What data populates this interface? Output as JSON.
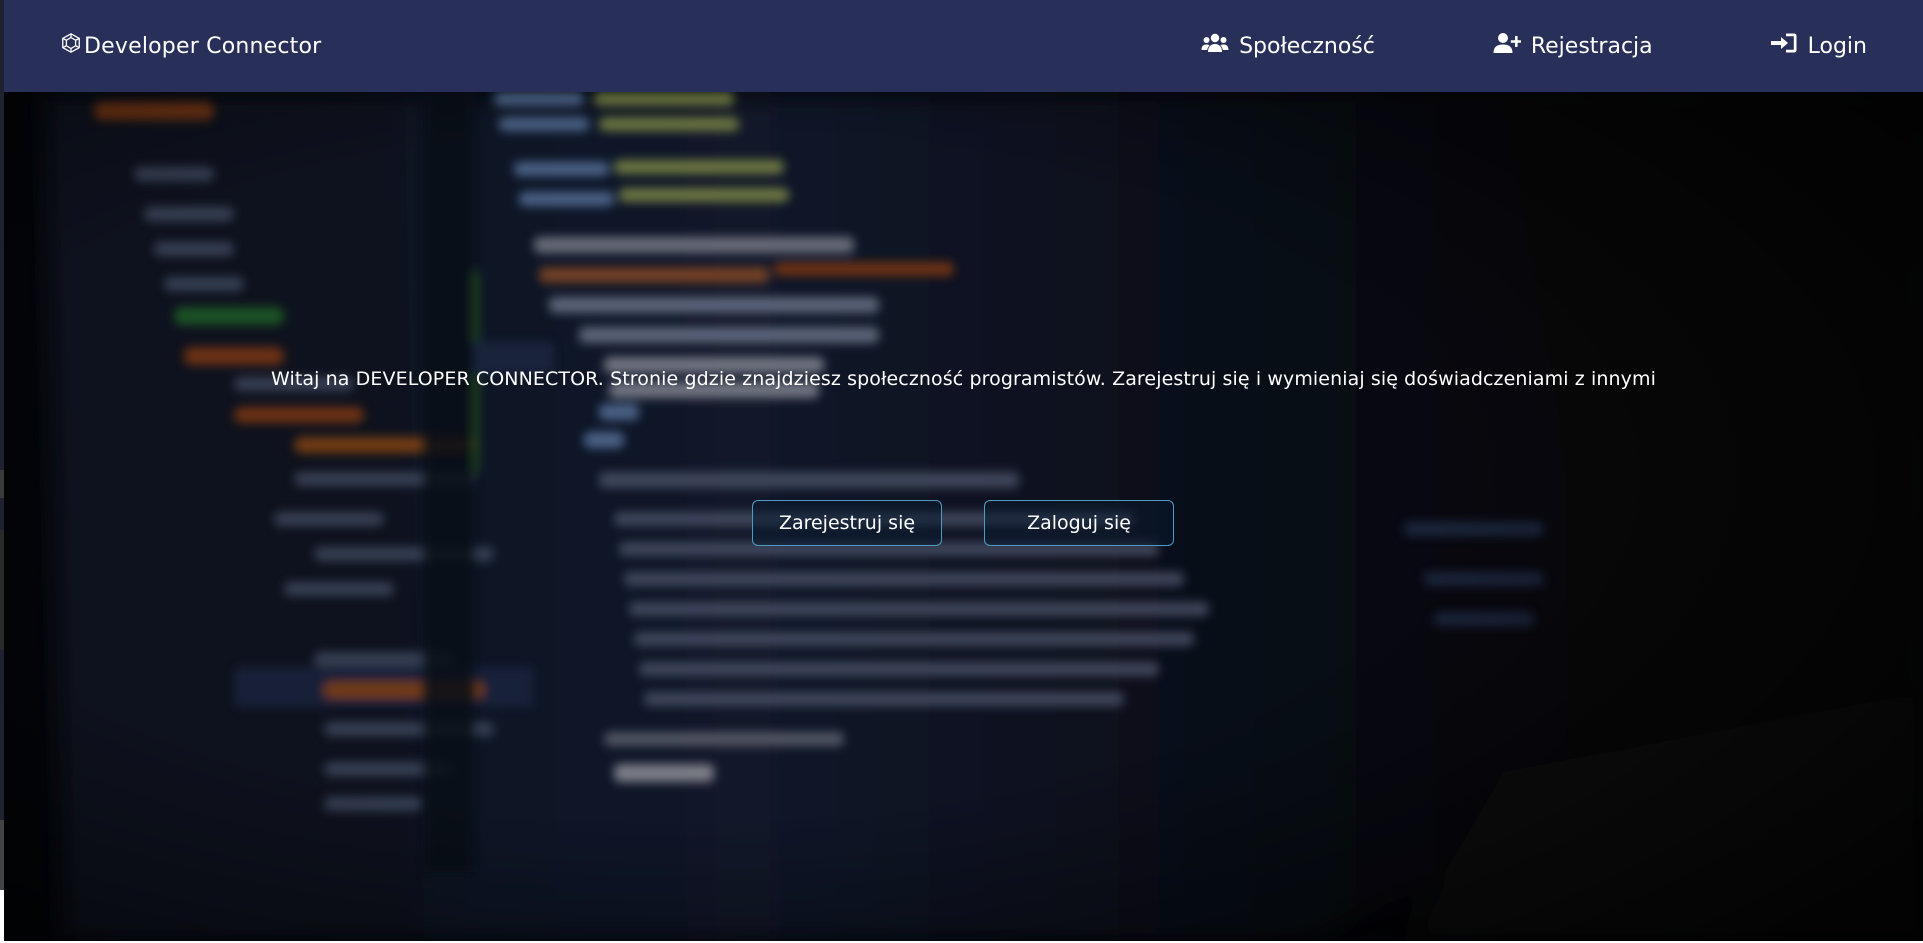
{
  "navbar": {
    "brand_icon": "code-hexagon-icon",
    "brand_label": "Developer Connector",
    "links": [
      {
        "label": "Społeczność",
        "icon": "users-icon"
      },
      {
        "label": "Rejestracja",
        "icon": "user-plus-icon"
      },
      {
        "label": "Login",
        "icon": "sign-in-icon"
      }
    ],
    "background_color": "#283059"
  },
  "hero": {
    "background": "blurred-code-editor-photo",
    "lead_text": "Witaj na DEVELOPER CONNECTOR. Stronie gdzie znajdziesz społeczność programistów. Zarejestruj się i wymieniaj się doświadczeniami z innymi",
    "buttons": {
      "register_label": "Zarejestruj się",
      "login_label": "Zaloguj się"
    },
    "button_border_color": "#4f9bc4"
  }
}
